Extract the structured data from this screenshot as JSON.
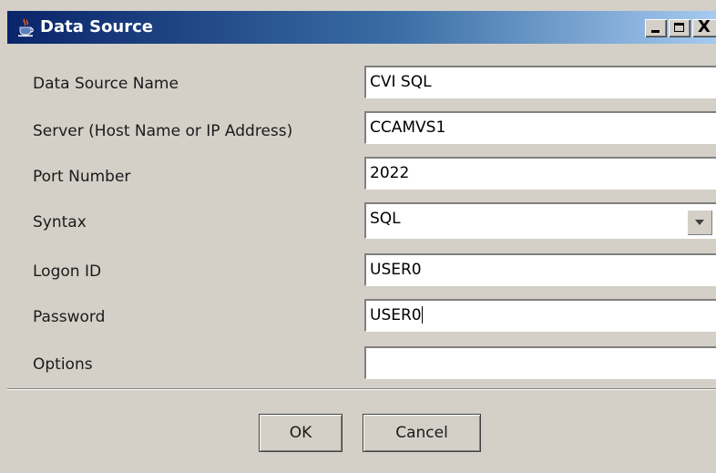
{
  "window": {
    "title": "Data Source",
    "icon": "java-cup-icon",
    "controls": {
      "minimize": "minimize-icon",
      "maximize": "maximize-icon",
      "close": "close-icon",
      "close_glyph": "X"
    }
  },
  "form": {
    "data_source_name": {
      "label": "Data Source Name",
      "value": "CVI SQL"
    },
    "server": {
      "label": "Server (Host Name or IP Address)",
      "value": "CCAMVS1"
    },
    "port": {
      "label": "Port Number",
      "value": "2022"
    },
    "syntax": {
      "label": "Syntax",
      "value": "SQL",
      "dropdown_icon": "chevron-down-icon"
    },
    "logon_id": {
      "label": "Logon ID",
      "value": "USER0"
    },
    "password": {
      "label": "Password",
      "value": "USER0"
    },
    "options": {
      "label": "Options",
      "value": ""
    }
  },
  "buttons": {
    "ok": "OK",
    "cancel": "Cancel"
  },
  "colors": {
    "titlebar_start": "#0a246a",
    "titlebar_end": "#a6caf0",
    "window_bg": "#d4d0c8"
  }
}
